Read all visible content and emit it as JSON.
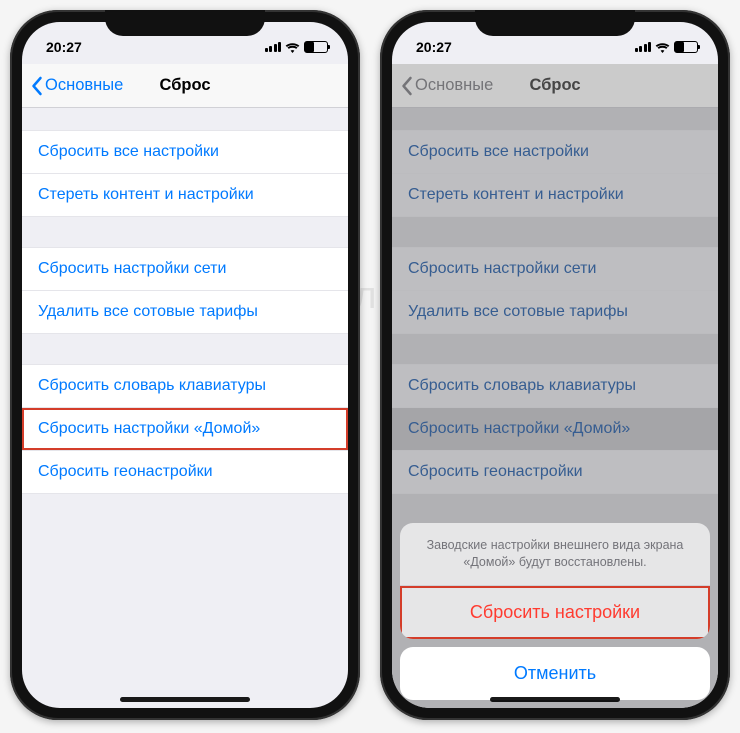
{
  "watermark": "Яблык",
  "statusBar": {
    "time": "20:27"
  },
  "nav": {
    "back": "Основные",
    "title": "Сброс"
  },
  "groups": [
    {
      "items": [
        {
          "label": "Сбросить все настройки"
        },
        {
          "label": "Стереть контент и настройки"
        }
      ]
    },
    {
      "items": [
        {
          "label": "Сбросить настройки сети"
        },
        {
          "label": "Удалить все сотовые тарифы"
        }
      ]
    },
    {
      "items": [
        {
          "label": "Сбросить словарь клавиатуры"
        },
        {
          "label": "Сбросить настройки «Домой»"
        },
        {
          "label": "Сбросить геонастройки"
        }
      ]
    }
  ],
  "actionSheet": {
    "message": "Заводские настройки внешнего вида экрана «Домой» будут восстановлены.",
    "destructive": "Сбросить настройки",
    "cancel": "Отменить"
  }
}
